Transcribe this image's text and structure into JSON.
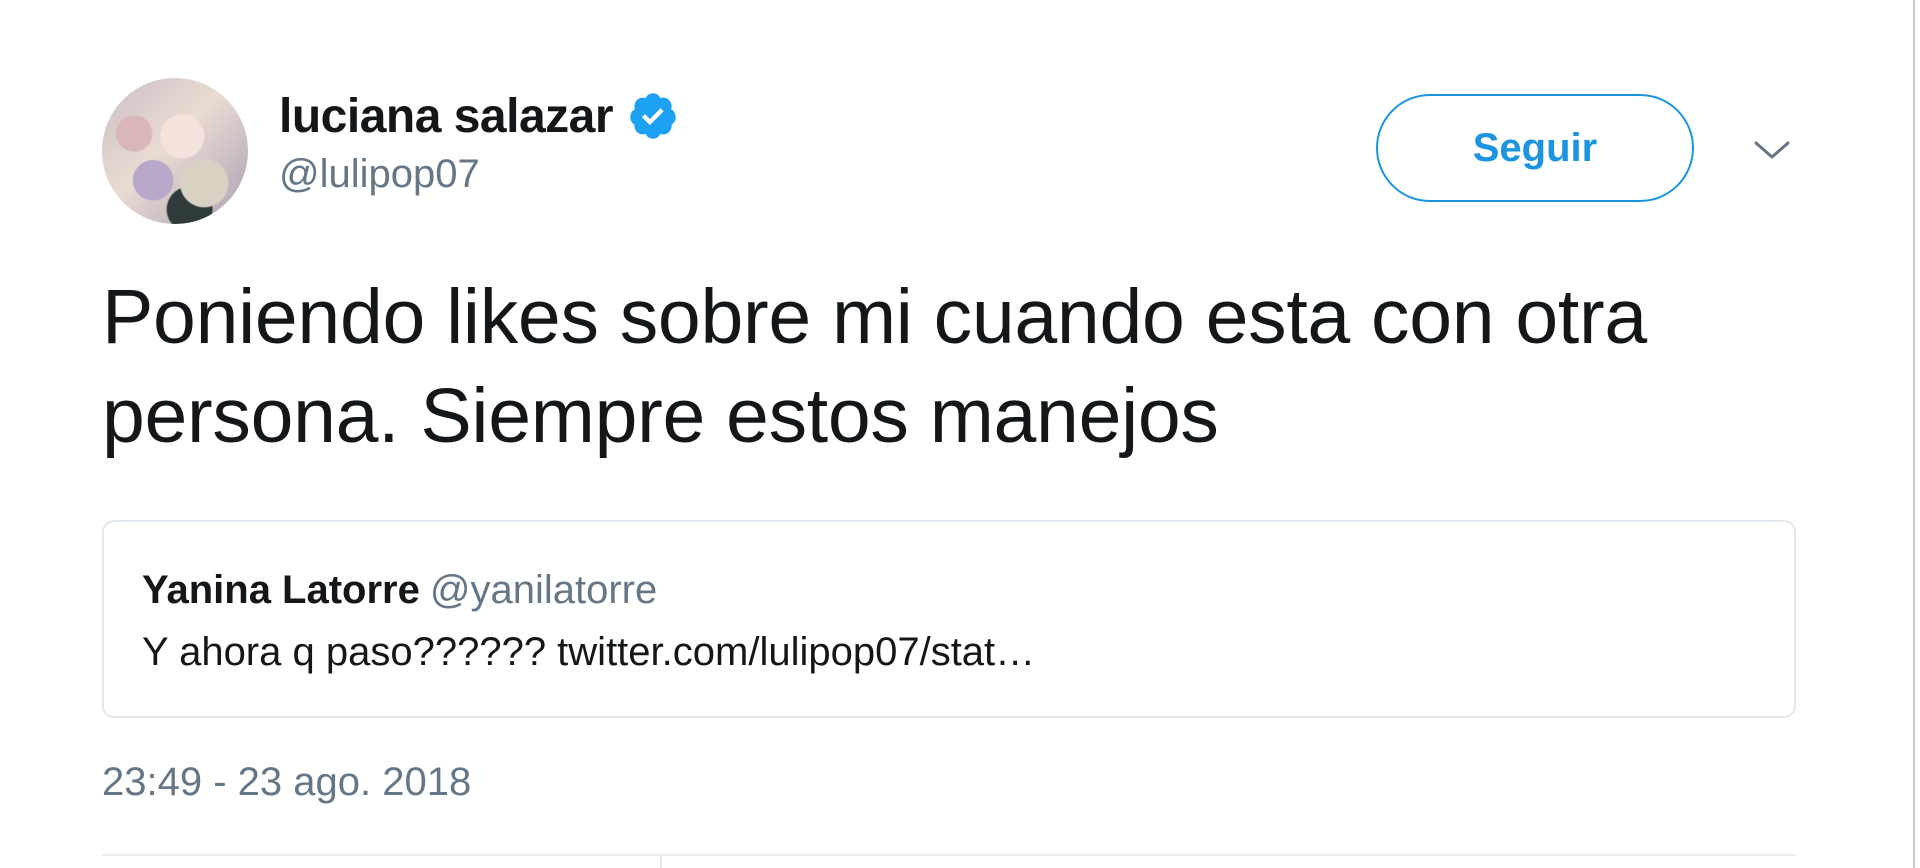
{
  "author": {
    "display_name": "luciana salazar",
    "handle": "@lulipop07",
    "verified": true
  },
  "follow_button": {
    "label": "Seguir"
  },
  "tweet": {
    "text": "Poniendo likes sobre mi cuando esta con otra persona. Siempre estos manejos",
    "timestamp": "23:49 - 23 ago. 2018"
  },
  "quoted_tweet": {
    "author_name": "Yanina Latorre",
    "author_handle": "@yanilatorre",
    "text": "Y ahora q paso?????? twitter.com/lulipop07/stat…"
  },
  "colors": {
    "accent": "#1b95e0",
    "verified": "#1da1f2",
    "secondary_text": "#657786",
    "border": "#e1e8ed"
  },
  "icons": {
    "verified": "verified-badge-icon",
    "caret": "chevron-down-icon"
  }
}
